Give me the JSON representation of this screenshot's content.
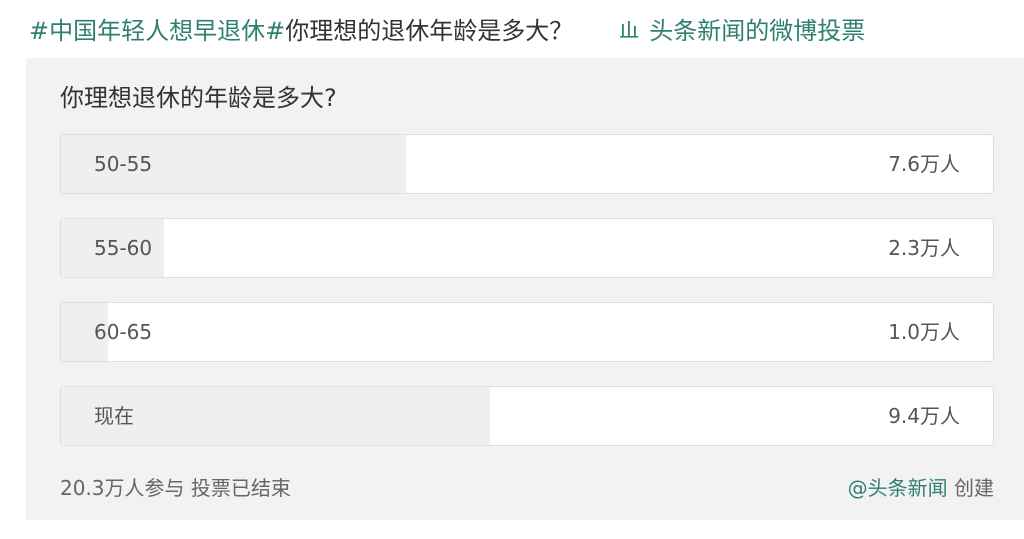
{
  "header": {
    "hashtag": "#中国年轻人想早退休#",
    "title": "你理想的退休年龄是多大？",
    "source_label": "头条新闻的微博投票",
    "source_icon": "bar-chart-icon"
  },
  "poll": {
    "question": "你理想退休的年龄是多大?",
    "options": [
      {
        "label": "50-55",
        "count": "7.6万人",
        "share": 0.37
      },
      {
        "label": "55-60",
        "count": "2.3万人",
        "share": 0.11
      },
      {
        "label": "60-65",
        "count": "1.0万人",
        "share": 0.05
      },
      {
        "label": "现在",
        "count": "9.4万人",
        "share": 0.46
      }
    ],
    "participants": "20.3万人参与",
    "status": "投票已结束",
    "creator": "@头条新闻",
    "created_label": "创建"
  },
  "colors": {
    "accent": "#2f7f72",
    "card_bg": "#f2f2f2",
    "bar_fill": "#efefef"
  }
}
